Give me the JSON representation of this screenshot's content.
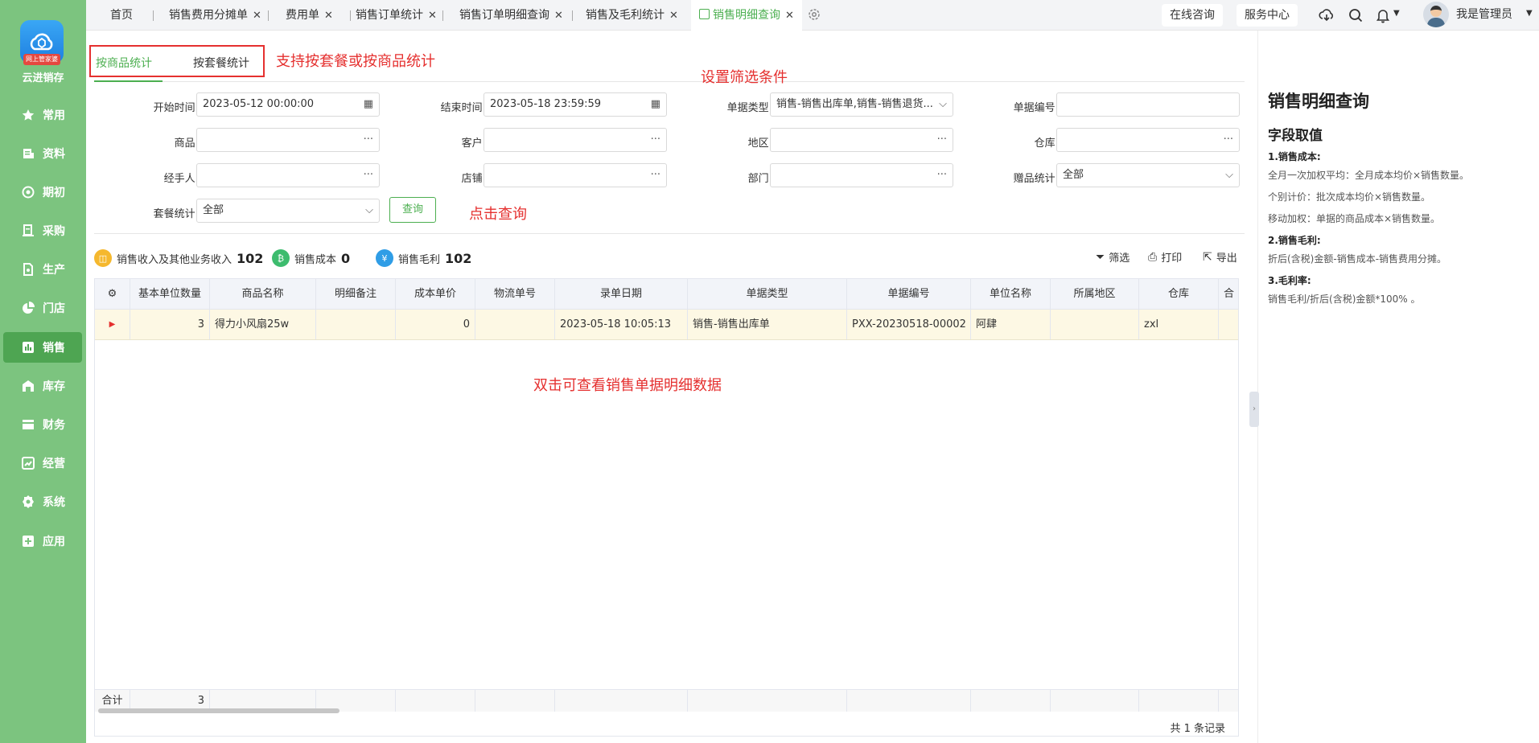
{
  "sidebar": {
    "logo_badge": "网上管家婆",
    "brand": "云进销存",
    "items": [
      {
        "label": "常用",
        "icon": "star-icon"
      },
      {
        "label": "资料",
        "icon": "document-icon"
      },
      {
        "label": "期初",
        "icon": "target-icon"
      },
      {
        "label": "采购",
        "icon": "purchase-icon"
      },
      {
        "label": "生产",
        "icon": "production-icon"
      },
      {
        "label": "门店",
        "icon": "pie-icon"
      },
      {
        "label": "销售",
        "icon": "bar-chart-icon"
      },
      {
        "label": "库存",
        "icon": "warehouse-icon"
      },
      {
        "label": "财务",
        "icon": "finance-icon"
      },
      {
        "label": "经营",
        "icon": "trend-icon"
      },
      {
        "label": "系统",
        "icon": "gear-icon"
      },
      {
        "label": "应用",
        "icon": "plus-square-icon"
      }
    ],
    "active_index": 6
  },
  "tabs": [
    {
      "label": "首页"
    },
    {
      "label": "销售费用分摊单"
    },
    {
      "label": "费用单"
    },
    {
      "label": "销售订单统计"
    },
    {
      "label": "销售订单明细查询"
    },
    {
      "label": "销售及毛利统计"
    },
    {
      "label": "销售明细查询"
    }
  ],
  "header": {
    "online_consult": "在线咨询",
    "service_center": "服务中心",
    "user_name": "我是管理员"
  },
  "subtabs": {
    "by_goods": "按商品统计",
    "by_package": "按套餐统计"
  },
  "annotations": {
    "subtab_note": "支持按套餐或按商品统计",
    "filter_note": "设置筛选条件",
    "query_note": "点击查询",
    "dblclick_note": "双击可查看销售单据明细数据"
  },
  "filters": {
    "start_time": {
      "label": "开始时间:",
      "value": "2023-05-12 00:00:00"
    },
    "end_time": {
      "label": "结束时间:",
      "value": "2023-05-18 23:59:59"
    },
    "bill_type": {
      "label": "单据类型:",
      "value": "销售-销售出库单,销售-销售退货..."
    },
    "bill_no": {
      "label": "单据编号:",
      "value": ""
    },
    "goods": {
      "label": "商品:",
      "value": ""
    },
    "customer": {
      "label": "客户:",
      "value": ""
    },
    "region": {
      "label": "地区:",
      "value": ""
    },
    "warehouse": {
      "label": "仓库:",
      "value": ""
    },
    "handler": {
      "label": "经手人:",
      "value": ""
    },
    "store": {
      "label": "店铺:",
      "value": ""
    },
    "department": {
      "label": "部门:",
      "value": ""
    },
    "gift_stat": {
      "label": "赠品统计:",
      "value": "全部"
    },
    "package_stat": {
      "label": "套餐统计:",
      "value": "全部"
    },
    "query_button": "查询"
  },
  "stats": {
    "income": {
      "label": "销售收入及其他业务收入",
      "value": "102"
    },
    "cost": {
      "label": "销售成本",
      "value": "0"
    },
    "profit": {
      "label": "销售毛利",
      "value": "102"
    }
  },
  "toolbar": {
    "filter": "筛选",
    "print": "打印",
    "export": "导出"
  },
  "table": {
    "columns": [
      "基本单位数量",
      "商品名称",
      "明细备注",
      "成本单价",
      "物流单号",
      "录单日期",
      "单据类型",
      "单据编号",
      "单位名称",
      "所属地区",
      "仓库",
      "合"
    ],
    "rows": [
      {
        "qty": "3",
        "name": "得力小风扇25w",
        "remark": "",
        "unit_cost": "0",
        "logistics": "",
        "date": "2023-05-18 10:05:13",
        "type": "销售-销售出库单",
        "no": "PXX-20230518-00002",
        "partner": "阿肆",
        "region": "",
        "warehouse": "zxl"
      }
    ],
    "footer": {
      "label": "合计",
      "qty": "3"
    },
    "records": "共 1 条记录"
  },
  "panel": {
    "title": "销售明细查询",
    "subtitle": "字段取值",
    "sections": [
      {
        "heading": "1.销售成本:",
        "lines": [
          "全月一次加权平均：全月成本均价×销售数量。",
          "个别计价：批次成本均价×销售数量。",
          "移动加权：单据的商品成本×销售数量。"
        ]
      },
      {
        "heading": "2.销售毛利:",
        "lines": [
          "折后(含税)金额-销售成本-销售费用分摊。"
        ]
      },
      {
        "heading": "3.毛利率:",
        "lines": [
          "销售毛利/折后(含税)金额*100% 。"
        ]
      }
    ]
  },
  "colors": {
    "sidebar": "#7cc47f",
    "accent": "#4caf50",
    "annotation": "#e5302f"
  }
}
